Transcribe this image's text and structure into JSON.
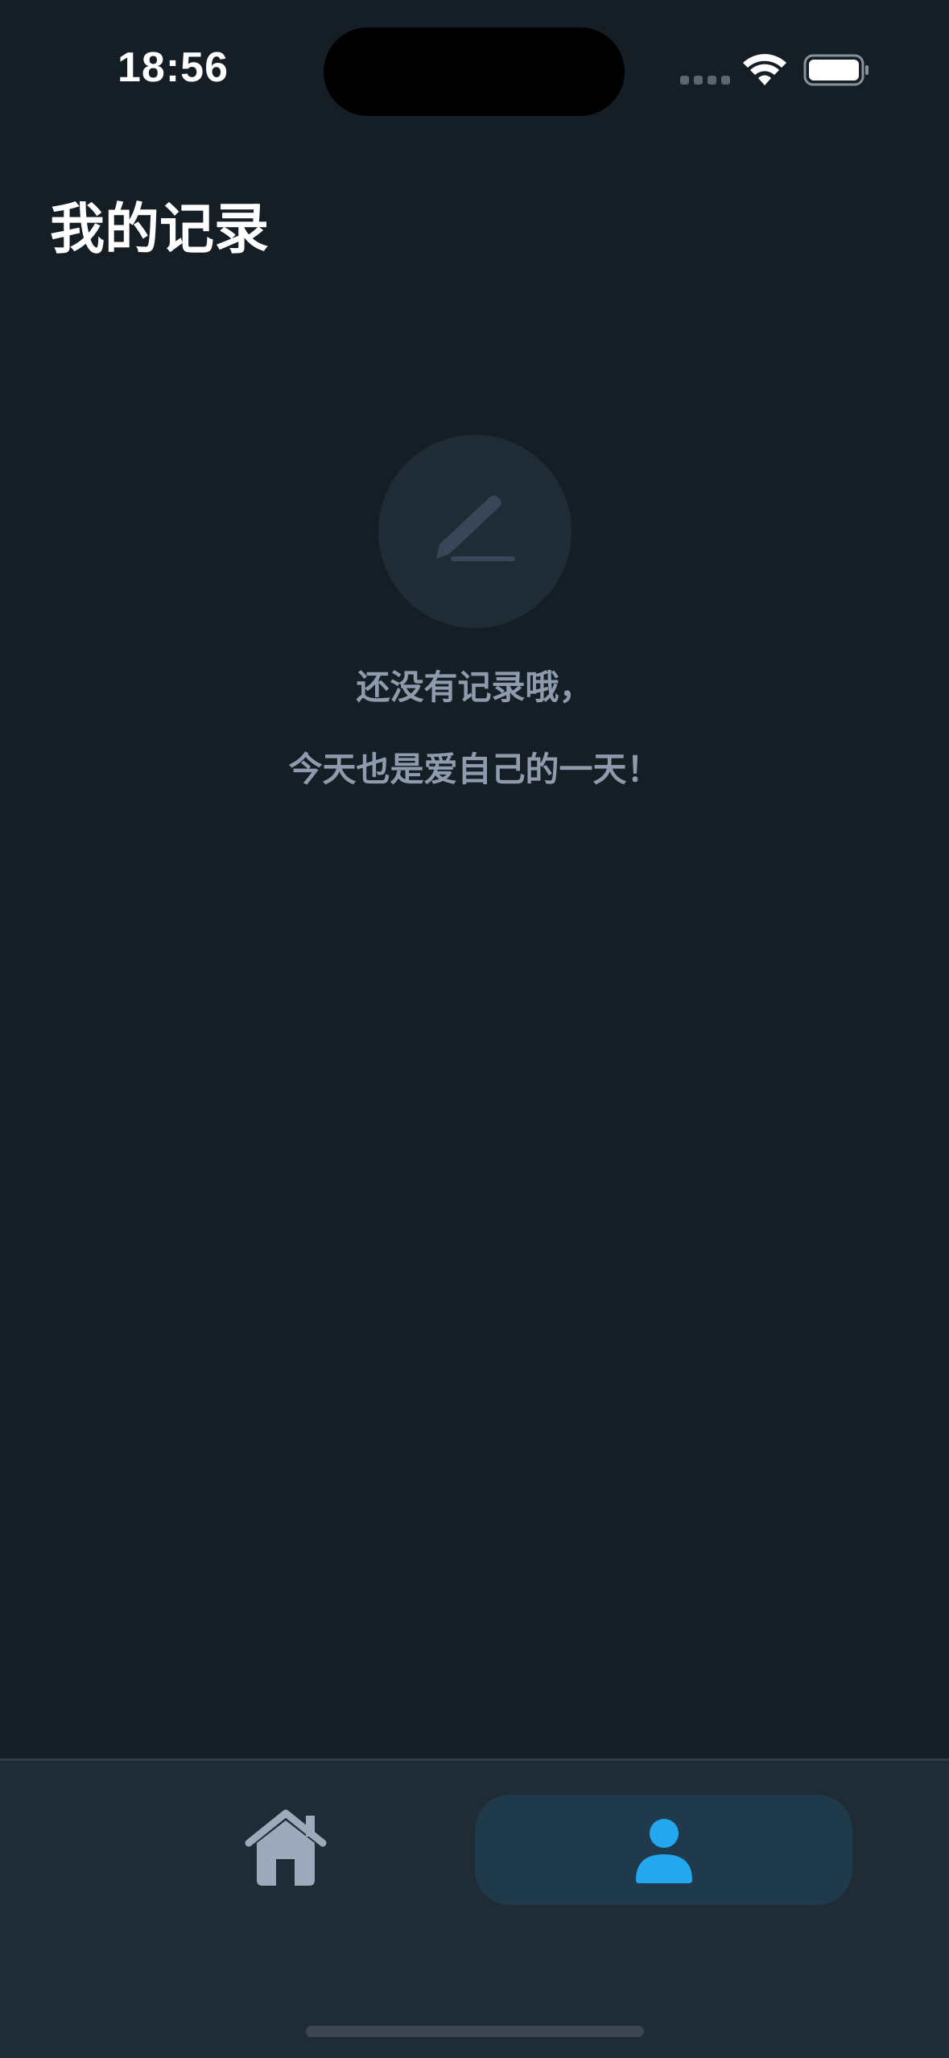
{
  "status_bar": {
    "time": "18:56"
  },
  "header": {
    "title": "我的记录"
  },
  "empty_state": {
    "icon": "pencil-icon",
    "line1": "还没有记录哦，",
    "line2": "今天也是爱自己的一天！"
  },
  "tab_bar": {
    "tabs": [
      {
        "icon": "home-icon",
        "active": false
      },
      {
        "icon": "person-icon",
        "active": true
      }
    ]
  },
  "colors": {
    "background": "#151e25",
    "tab_bar": "#202c35",
    "accent": "#23a7ee",
    "muted_text": "#8d9bad",
    "inactive_icon": "#9ea9bb"
  }
}
